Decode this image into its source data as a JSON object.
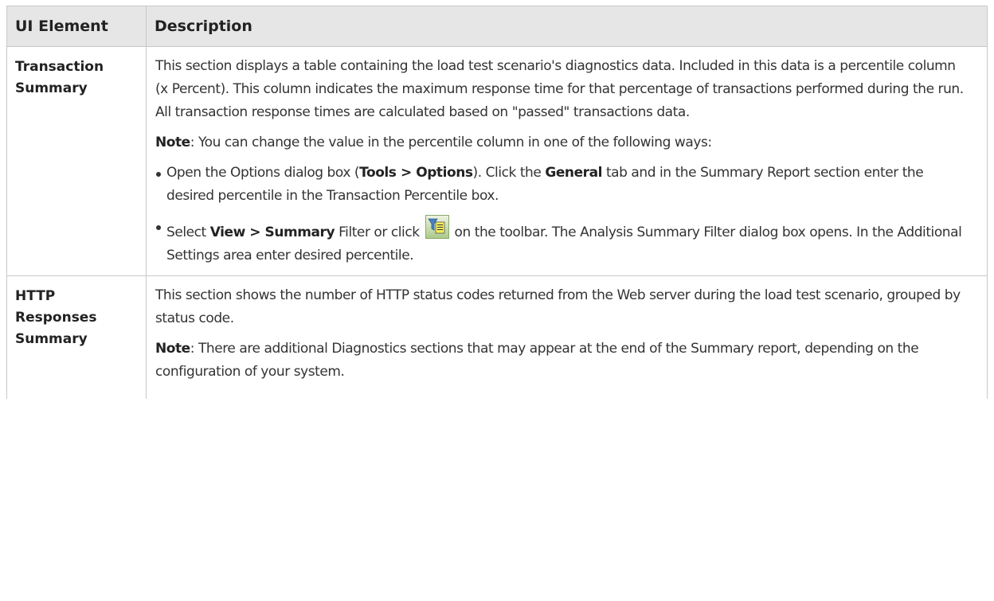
{
  "table": {
    "headers": {
      "element": "UI Element",
      "description": "Description"
    },
    "rows": [
      {
        "element_line1": "Transaction",
        "element_line2": "Summary",
        "para1": "This section displays a table containing the load test scenario's diagnostics data. Included in this data is a percentile column (x Percent). This column indicates the maximum response time for that percentage of transactions performed during the run. All transaction response times are calculated based on \"passed\" transactions data.",
        "note_label": "Note",
        "note_text": ": You can change the value in the percentile column in one of the following ways:",
        "bullet1": {
          "t1": "Open the Options dialog box (",
          "b1": "Tools > Options",
          "t2": "). Click the ",
          "b2": "General",
          "t3": " tab and in the Summary Report section enter the desired percentile in the Transaction Percentile box."
        },
        "bullet2": {
          "t1": "Select ",
          "b1": "View > Summary",
          "t2": " Filter or click ",
          "icon": "summary-filter-icon",
          "t3": " on the toolbar. The Analysis Summary Filter dialog box opens. In the Additional Settings area enter desired percentile."
        }
      },
      {
        "element_line1": "HTTP",
        "element_line2": "Responses",
        "element_line3": "Summary",
        "para1": "This section shows the number of HTTP status codes returned from the Web server during the load test scenario, grouped by status code.",
        "note_label": "Note",
        "note_text": ": There are additional Diagnostics sections that may appear at the end of the Summary report, depending on the configuration of your system."
      }
    ]
  }
}
